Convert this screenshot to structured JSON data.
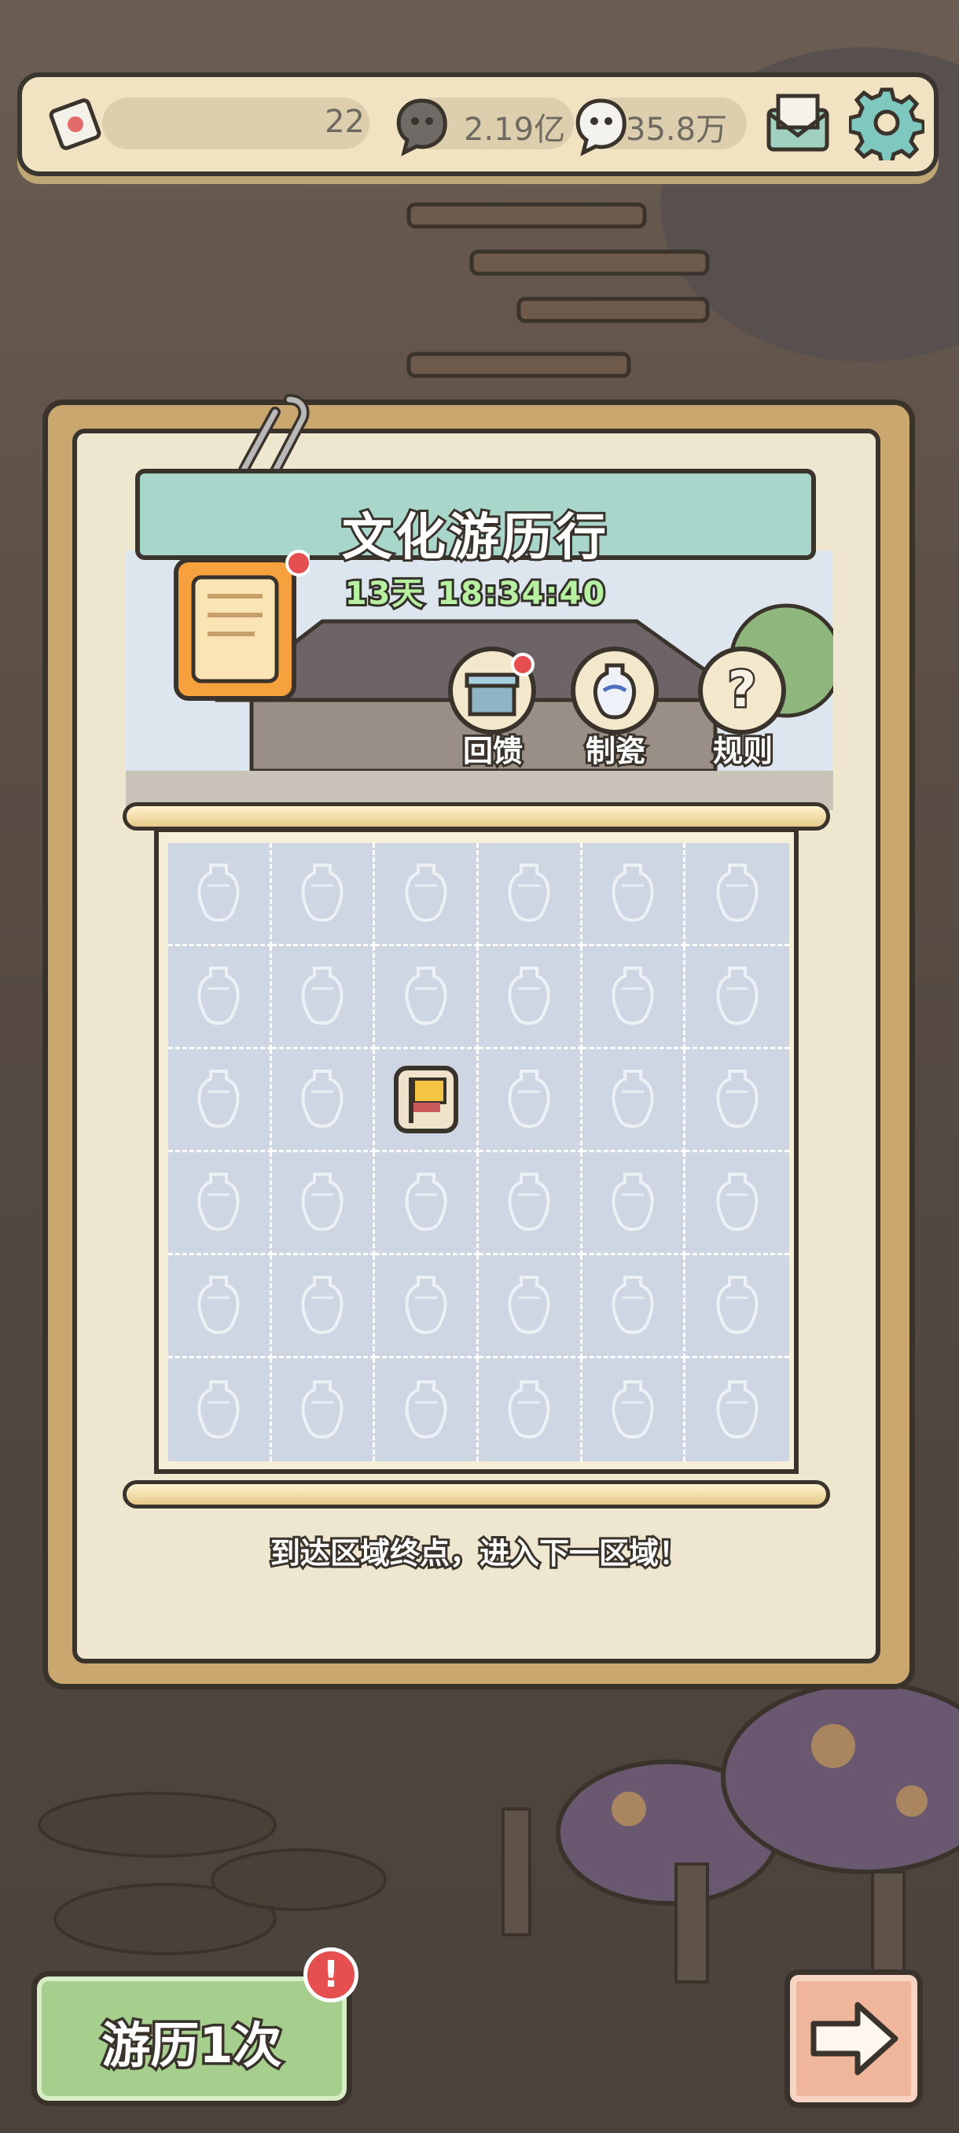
{
  "topbar": {
    "ticket_count": "22",
    "dark_currency": "2.19亿",
    "light_currency": "35.8万",
    "icons": [
      "ticket-icon",
      "dark-coin-icon",
      "light-coin-icon",
      "mail-icon",
      "gear-icon"
    ]
  },
  "event": {
    "title": "文化游历行",
    "timer": "13天 18:34:40"
  },
  "side_buttons": [
    {
      "label": "回馈",
      "icon": "gift-box-icon",
      "badge": true
    },
    {
      "label": "制瓷",
      "icon": "vase-icon",
      "badge": false
    },
    {
      "label": "规则",
      "icon": "question-icon",
      "badge": false
    }
  ],
  "grid": {
    "rows": 6,
    "cols": 6,
    "flag_position": {
      "row": 3,
      "col": 3
    }
  },
  "hint": "到达区域终点，进入下一区域！",
  "bottom": {
    "travel_label": "游历1次",
    "travel_alert": "!"
  },
  "colors": {
    "banner": "#a9d6cb",
    "timer_text": "#b6f0a0",
    "travel_button": "#a6cf8e",
    "next_button": "#f0b69c",
    "badge": "#e54f4f"
  }
}
